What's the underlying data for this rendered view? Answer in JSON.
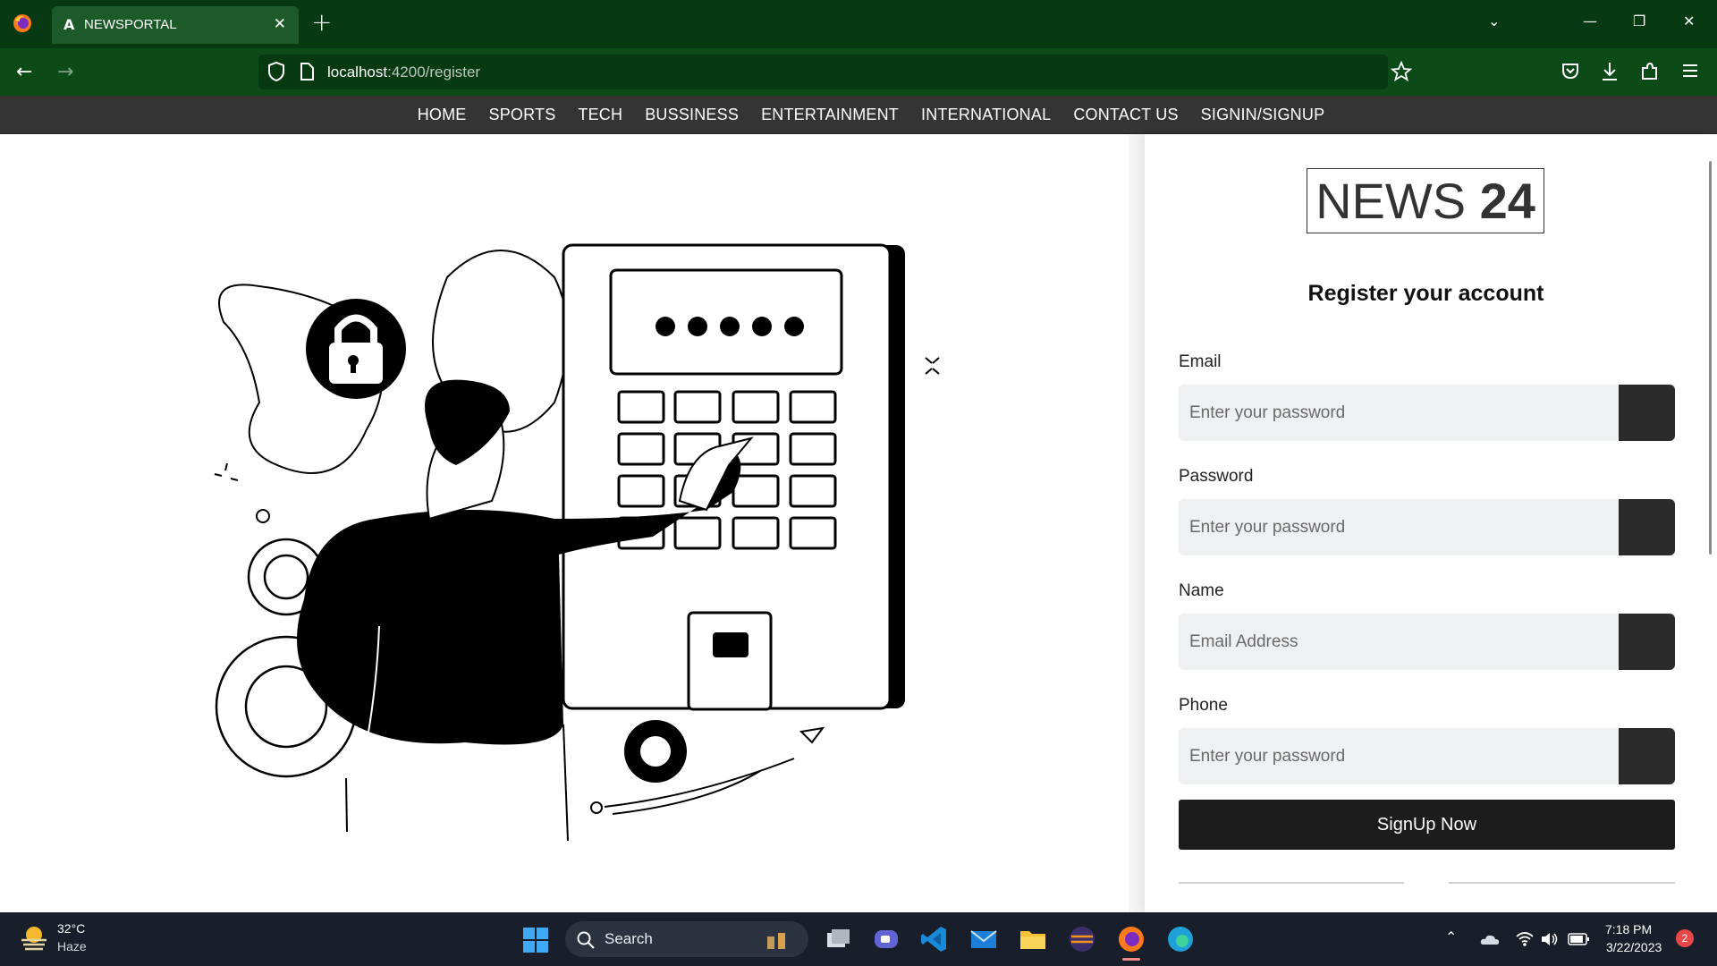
{
  "browser": {
    "tab_title": "NEWSPORTAL",
    "tab_icon": "angular-icon",
    "url_host": "localhost",
    "url_rest": ":4200/register"
  },
  "site_nav": {
    "items": [
      "HOME",
      "SPORTS",
      "TECH",
      "BUSSINESS",
      "ENTERTAINMENT",
      "INTERNATIONAL",
      "CONTACT US",
      "SIGNIN/SIGNUP"
    ]
  },
  "logo": {
    "word": "NEWS",
    "number": "24"
  },
  "form": {
    "title": "Register your account",
    "fields": [
      {
        "label": "Email",
        "placeholder": "Enter your password"
      },
      {
        "label": "Password",
        "placeholder": "Enter your password"
      },
      {
        "label": "Name",
        "placeholder": "Email Address"
      },
      {
        "label": "Phone",
        "placeholder": "Enter your password"
      }
    ],
    "submit_label": "SignUp Now"
  },
  "taskbar": {
    "weather_temp": "32°C",
    "weather_desc": "Haze",
    "search_label": "Search",
    "time": "7:18 PM",
    "date": "3/22/2023",
    "notification_count": "2"
  },
  "colors": {
    "browser_chrome": "#0c4a18",
    "site_nav": "#343434",
    "button": "#1c1c1c",
    "input_bg": "#eff0f2"
  }
}
